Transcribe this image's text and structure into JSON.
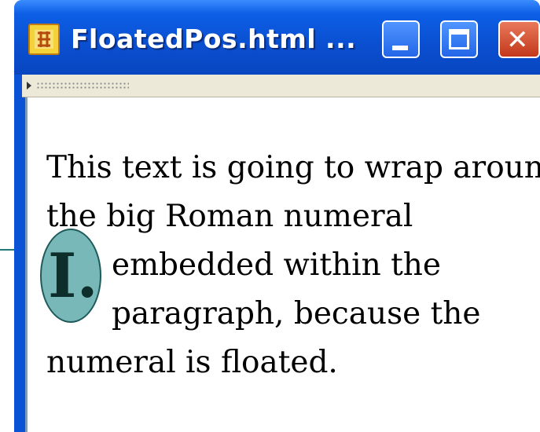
{
  "window": {
    "title": "FloatedPos.html ...",
    "buttons": {
      "minimize": "minimize",
      "maximize": "maximize",
      "close": "✕"
    }
  },
  "toolbar": {
    "grip_icon": "toolbar-grip-icon"
  },
  "content": {
    "lines": [
      "This text is going to wrap around",
      "the big Roman numeral",
      "embedded within the",
      "paragraph, because the",
      "numeral is floated."
    ],
    "numeral": "I."
  },
  "colors": {
    "titlebar": "#0a4fd0",
    "numeral_fill": "#78b8b8",
    "numeral_border": "#1f5a5a",
    "arrow": "#1f7a7a"
  }
}
